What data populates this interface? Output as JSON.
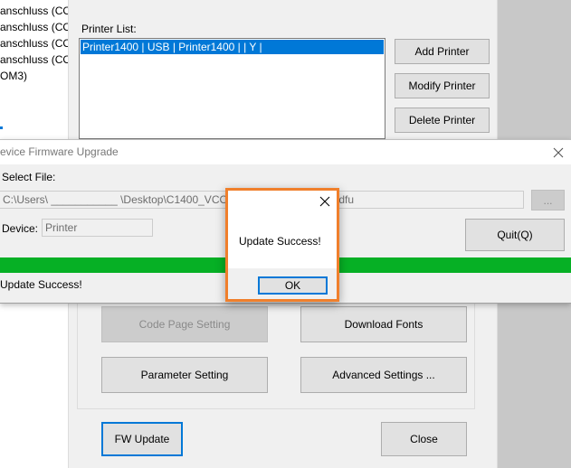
{
  "left_pane": {
    "items": [
      "anschluss (COM",
      "anschluss (COM",
      "anschluss (COM",
      "anschluss (COM",
      "OM3)"
    ]
  },
  "main_window": {
    "printer_list_label": "Printer List:",
    "printer_list_row": "Printer1400 | USB | Printer1400 |  | Y |",
    "buttons": {
      "add_printer": "Add Printer",
      "modify_printer": "Modify Printer",
      "delete_printer": "Delete Printer",
      "code_page_setting": "Code Page Setting",
      "download_fonts": "Download Fonts",
      "parameter_setting": "Parameter Setting",
      "advanced_settings": "Advanced Settings ...",
      "fw_update": "FW Update",
      "close": "Close"
    }
  },
  "fw_window": {
    "title": "evice Firmware Upgrade",
    "select_file_label": "Select File:",
    "file_path": "C:\\Users\\ ___________ \\Desktop\\C1400_VCOM_FW\\F",
    "file_path_tail": ".dfu",
    "browse_label": "...",
    "device_label": "Device:",
    "device_value": "Printer",
    "quit_label": "Quit(Q)",
    "progress_percent": 100,
    "status_text": "Update Success!",
    "progress_color": "#06b025"
  },
  "message_dialog": {
    "message": "Update Success!",
    "ok_label": "OK",
    "highlight_color": "#f07f2b"
  }
}
